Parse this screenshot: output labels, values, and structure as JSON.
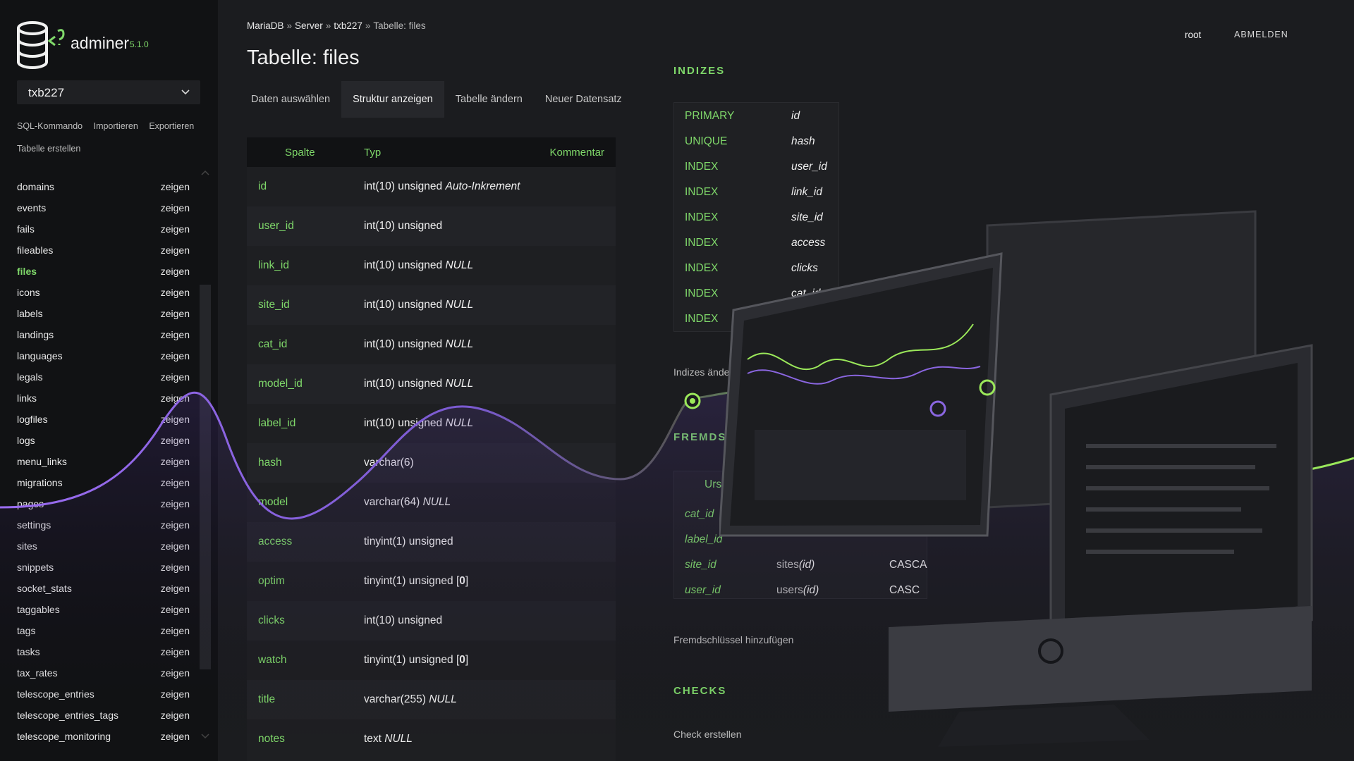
{
  "app": {
    "name": "adminer",
    "version": "5.1.0"
  },
  "sidebar": {
    "db_selected": "txb227",
    "links": [
      "SQL-Kommando",
      "Importieren",
      "Exportieren",
      "Tabelle erstellen"
    ],
    "show_label": "zeigen",
    "tables": [
      "domains",
      "events",
      "fails",
      "fileables",
      "files",
      "icons",
      "labels",
      "landings",
      "languages",
      "legals",
      "links",
      "logfiles",
      "logs",
      "menu_links",
      "migrations",
      "pages",
      "settings",
      "sites",
      "snippets",
      "socket_stats",
      "taggables",
      "tags",
      "tasks",
      "tax_rates",
      "telescope_entries",
      "telescope_entries_tags",
      "telescope_monitoring"
    ],
    "active_table": "files"
  },
  "breadcrumb": [
    "MariaDB",
    "Server",
    "txb227",
    "Tabelle: files"
  ],
  "breadcrumb_sep": "»",
  "page_title": "Tabelle: files",
  "tabs": [
    "Daten auswählen",
    "Struktur anzeigen",
    "Tabelle ändern",
    "Neuer Datensatz"
  ],
  "active_tab": "Struktur anzeigen",
  "structure": {
    "headers": {
      "column": "Spalte",
      "type": "Typ",
      "comment": "Kommentar"
    },
    "rows": [
      {
        "name": "id",
        "type": "int(10) unsigned",
        "extra": "Auto-Inkrement",
        "default": ""
      },
      {
        "name": "user_id",
        "type": "int(10) unsigned",
        "extra": "",
        "default": ""
      },
      {
        "name": "link_id",
        "type": "int(10) unsigned",
        "extra": "NULL",
        "default": ""
      },
      {
        "name": "site_id",
        "type": "int(10) unsigned",
        "extra": "NULL",
        "default": ""
      },
      {
        "name": "cat_id",
        "type": "int(10) unsigned",
        "extra": "NULL",
        "default": ""
      },
      {
        "name": "model_id",
        "type": "int(10) unsigned",
        "extra": "NULL",
        "default": ""
      },
      {
        "name": "label_id",
        "type": "int(10) unsigned",
        "extra": "NULL",
        "default": ""
      },
      {
        "name": "hash",
        "type": "varchar(6)",
        "extra": "",
        "default": ""
      },
      {
        "name": "model",
        "type": "varchar(64)",
        "extra": "NULL",
        "default": ""
      },
      {
        "name": "access",
        "type": "tinyint(1) unsigned",
        "extra": "",
        "default": ""
      },
      {
        "name": "optim",
        "type": "tinyint(1) unsigned",
        "extra": "",
        "default": "0"
      },
      {
        "name": "clicks",
        "type": "int(10) unsigned",
        "extra": "",
        "default": ""
      },
      {
        "name": "watch",
        "type": "tinyint(1) unsigned",
        "extra": "",
        "default": "0"
      },
      {
        "name": "title",
        "type": "varchar(255)",
        "extra": "NULL",
        "default": ""
      },
      {
        "name": "notes",
        "type": "text",
        "extra": "NULL",
        "default": ""
      }
    ]
  },
  "indexes": {
    "title": "INDIZES",
    "rows": [
      {
        "type": "PRIMARY",
        "col": "id"
      },
      {
        "type": "UNIQUE",
        "col": "hash"
      },
      {
        "type": "INDEX",
        "col": "user_id"
      },
      {
        "type": "INDEX",
        "col": "link_id"
      },
      {
        "type": "INDEX",
        "col": "site_id"
      },
      {
        "type": "INDEX",
        "col": "access"
      },
      {
        "type": "INDEX",
        "col": "clicks"
      },
      {
        "type": "INDEX",
        "col": "cat_id"
      },
      {
        "type": "INDEX",
        "col": "la"
      }
    ],
    "edit_link": "Indizes ändern"
  },
  "foreign_keys": {
    "title": "FREMDSCHLÜS",
    "header": "Ursprung",
    "rows": [
      {
        "source": "cat_id",
        "target": "",
        "target_col": "",
        "action": ""
      },
      {
        "source": "label_id",
        "target": "",
        "target_col": "",
        "action": ""
      },
      {
        "source": "site_id",
        "target": "sites",
        "target_col": "(id)",
        "action": "CASCA"
      },
      {
        "source": "user_id",
        "target": "users",
        "target_col": "(id)",
        "action": "CASC"
      }
    ],
    "add_link": "Fremdschlüssel hinzufügen"
  },
  "checks": {
    "title": "CHECKS",
    "create_link": "Check erstellen"
  },
  "header_right": {
    "user": "root",
    "logout": "ABMELDEN"
  },
  "colors": {
    "accent": "#7fd86a",
    "background": "#1b1c1f",
    "sidebar": "#111214",
    "wave": "#9a6cf0"
  }
}
